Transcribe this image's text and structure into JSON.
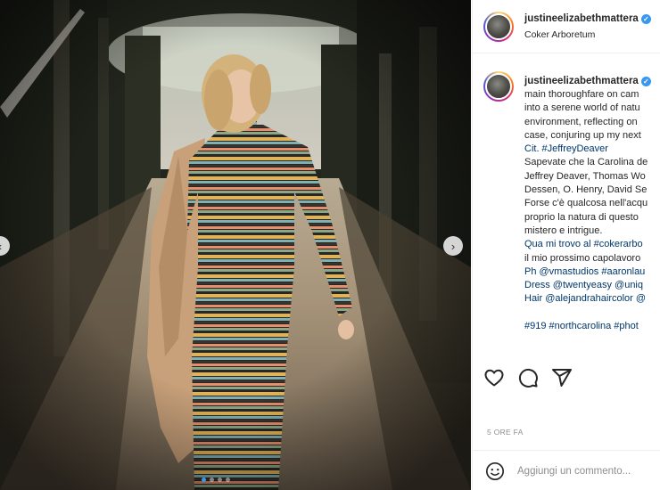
{
  "post": {
    "username": "justineelizabethmattera",
    "location": "Coker Arboretum",
    "caption_lines": [
      {
        "text": "main thoroughfare on cam",
        "tag": false
      },
      {
        "text": "into a serene world of natu",
        "tag": false
      },
      {
        "text": "environment, reflecting on",
        "tag": false
      },
      {
        "text": "case, conjuring up my next",
        "tag": false
      },
      {
        "text": "Cit. #JeffreyDeaver",
        "tag": true
      },
      {
        "text": "Sapevate che la Carolina de",
        "tag": false
      },
      {
        "text": "Jeffrey Deaver, Thomas Wo",
        "tag": false
      },
      {
        "text": "Dessen, O. Henry, David Se",
        "tag": false
      },
      {
        "text": "Forse c'è qualcosa nell'acqu",
        "tag": false
      },
      {
        "text": "proprio la natura di questo",
        "tag": false
      },
      {
        "text": "mistero e intrigue.",
        "tag": false
      },
      {
        "text": "Qua mi trovo al #cokerarbo",
        "tag": true
      },
      {
        "text": "il mio prossimo capolavoro",
        "tag": false
      },
      {
        "text": "Ph @vmastudios #aaronlau",
        "tag": true
      },
      {
        "text": "Dress @twentyeasy @uniq",
        "tag": true
      },
      {
        "text": "Hair @alejandrahaircolor @",
        "tag": true
      },
      {
        "text": "",
        "tag": false
      },
      {
        "text": "#919 #northcarolina #phot",
        "tag": true
      }
    ],
    "time_label": "5 ORE FA",
    "comment_placeholder": "Aggiungi un commento..."
  },
  "icons": {
    "like": "heart-icon",
    "comment": "comment-icon",
    "share": "share-icon",
    "emoji": "emoji-icon",
    "verified": "verified-badge-icon",
    "prev": "chevron-left-icon",
    "next": "chevron-right-icon"
  },
  "carousel": {
    "slide_count": 4,
    "active_index": 0
  },
  "colors": {
    "link": "#00376b",
    "verified": "#3897f0",
    "border": "#efefef",
    "muted": "#8e8e8e"
  }
}
